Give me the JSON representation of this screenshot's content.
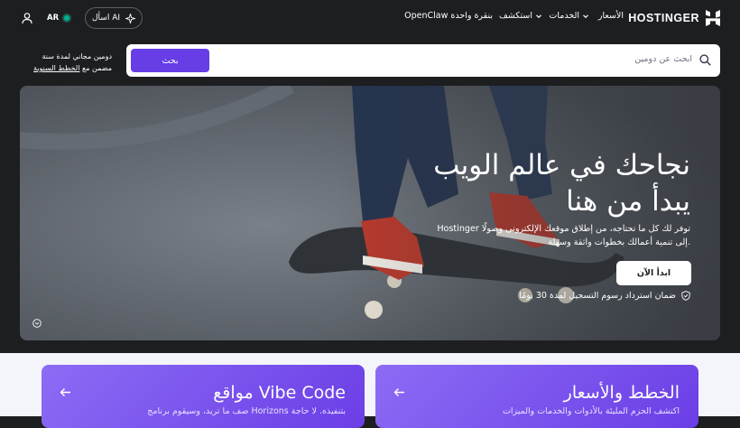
{
  "nav": {
    "brand": "HOSTINGER",
    "pricing": "الأسعار",
    "services": "الخدمات",
    "explore": "استكشف",
    "openclaw": "OpenClaw بنقرة واحدة",
    "ask_ai": "اسأل AI",
    "language": "AR"
  },
  "search": {
    "placeholder": "ابحث عن دومين",
    "button": "بحث",
    "promo_line1": "دومين مجاني لمدة سنة",
    "promo_prefix": "مضمن مع",
    "promo_link": "الخطط السنوية"
  },
  "hero": {
    "title_line1": "نجاحك في عالم الويب",
    "title_line2": "يبدأ من هنا",
    "description": "Hostinger توفر لك كل ما تحتاجه، من إطلاق موقعك الإلكتروني وصولًا إلى تنمية أعمالك بخطوات واثقة وسهلة.",
    "cta": "ابدأ الآن",
    "guarantee": "ضمان استرداد رسوم التسجيل لمدة 30 يومًا"
  },
  "cards": [
    {
      "title": "الخطط والأسعار",
      "description": "اكتشف الحزم المليئة بالأدوات والخدمات والميزات"
    },
    {
      "title": "مواقع Vibe Code",
      "description": "صف ما تريد، وسيقوم برنامج Horizons بتنفيذه. لا حاجة"
    }
  ],
  "icons": {
    "logo": "hostinger-logo-icon",
    "user": "user-icon",
    "ai": "sparkle-icon",
    "search": "search-icon",
    "shield": "shield-check-icon",
    "pause": "pause-icon",
    "arrow": "arrow-left-icon"
  },
  "colors": {
    "accent": "#673de6",
    "background": "#1d1e20",
    "card_gradient_start": "#8c6cf5",
    "card_gradient_end": "#6b3ee6",
    "status_dot": "#00b090"
  }
}
